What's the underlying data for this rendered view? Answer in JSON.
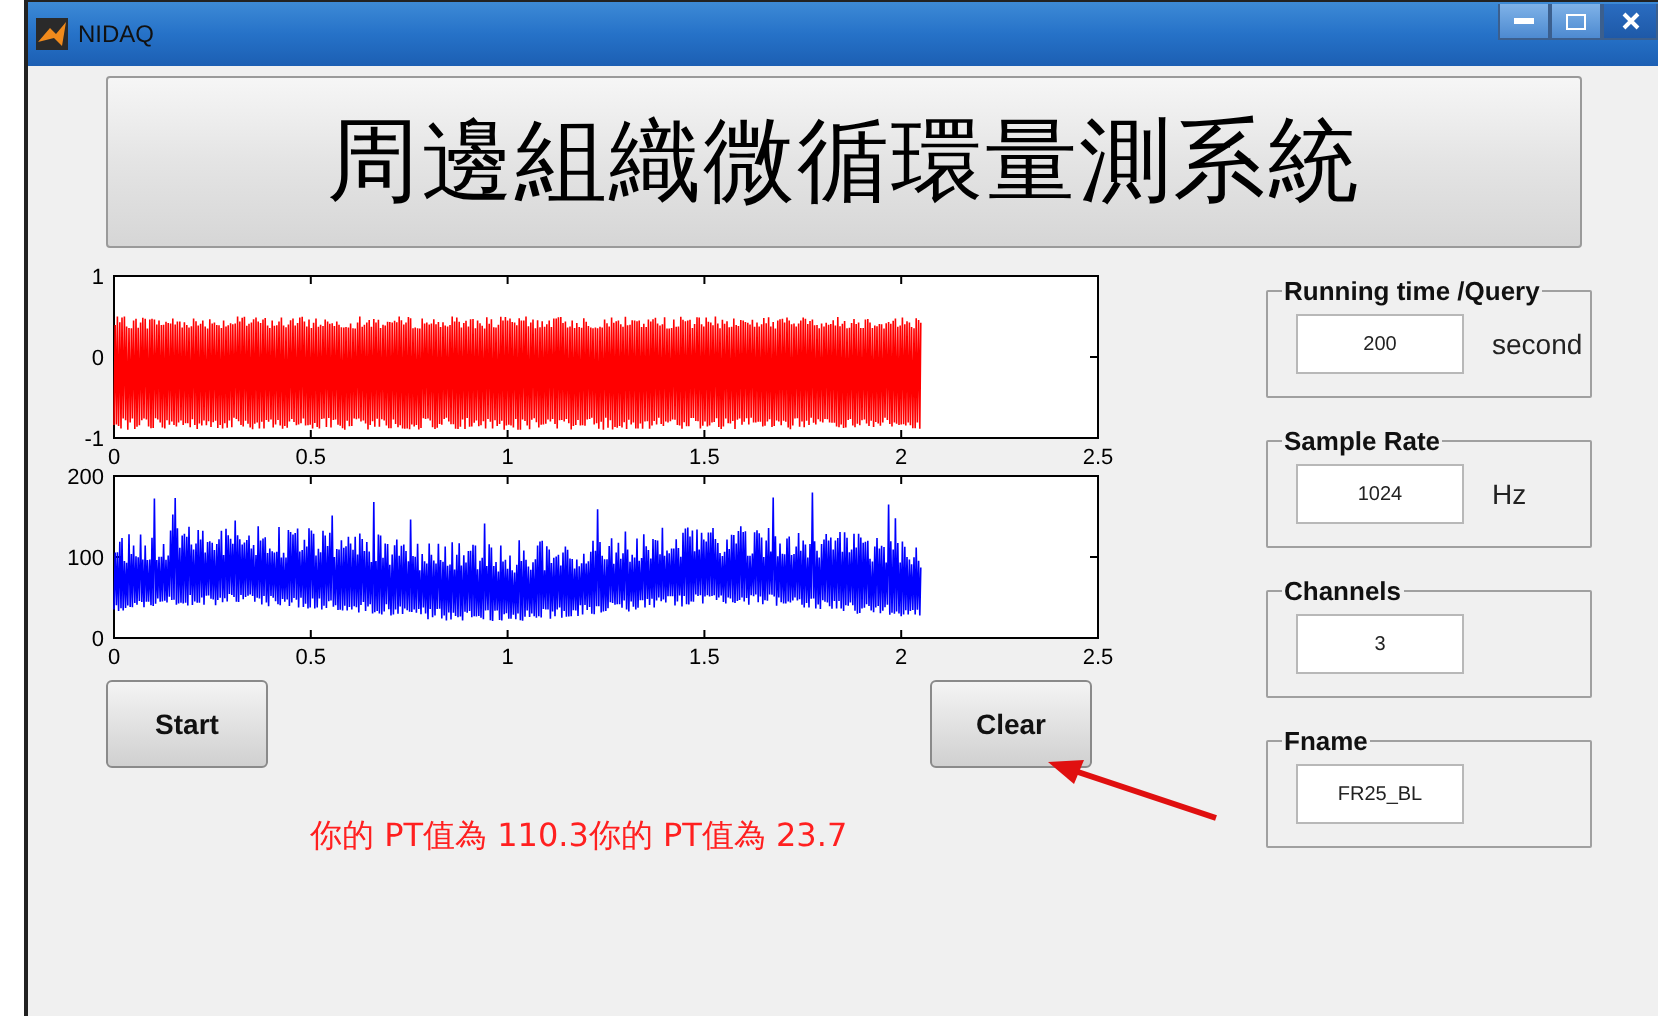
{
  "window": {
    "title": "NIDAQ"
  },
  "banner": {
    "title": "周邊組織微循環量測系統"
  },
  "plots": [
    {
      "color": "#ff0000",
      "y_ticks": [
        "1",
        "0",
        "-1"
      ],
      "x_ticks": [
        "0",
        "0.5",
        "1",
        "1.5",
        "2",
        "2.5"
      ],
      "kind": "bipolar"
    },
    {
      "color": "#0000ff",
      "y_ticks": [
        "200",
        "100",
        "0"
      ],
      "x_ticks": [
        "0",
        "0.5",
        "1",
        "1.5",
        "2",
        "2.5"
      ],
      "kind": "positive"
    }
  ],
  "buttons": [
    {
      "label": "Start"
    },
    {
      "label": "Clear"
    }
  ],
  "result": "你的 PT值為  110.3你的 PT值為  23.7",
  "groups": [
    {
      "title": "Running time /Query",
      "value": "200",
      "unit": "second"
    },
    {
      "title": "Sample Rate",
      "value": "1024",
      "unit": "Hz"
    },
    {
      "title": "Channels",
      "value": "3"
    },
    {
      "title": "Fname",
      "value": "FR25_BL"
    }
  ]
}
